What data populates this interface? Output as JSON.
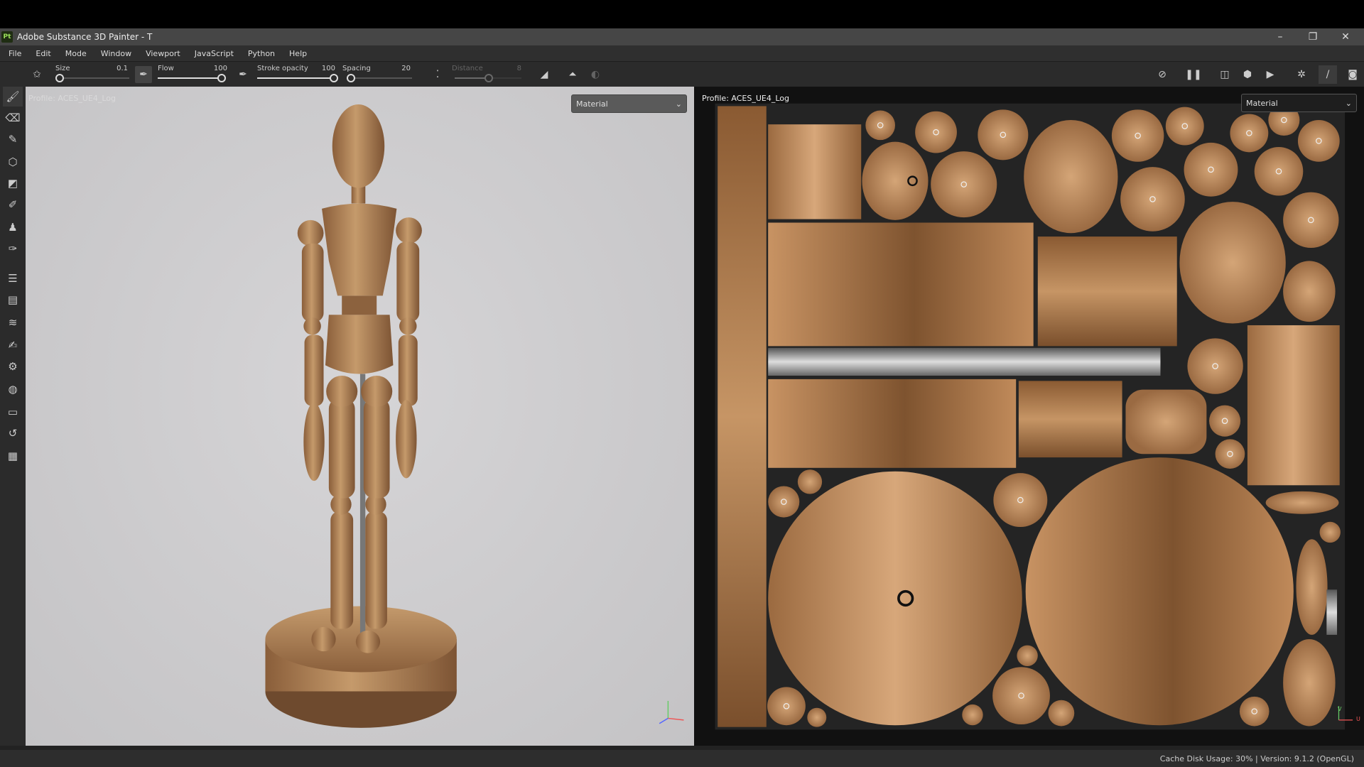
{
  "window": {
    "title": "Adobe Substance 3D Painter - T",
    "logo": "Pt",
    "minimize": "–",
    "restore": "❐",
    "close": "✕"
  },
  "menu": [
    "File",
    "Edit",
    "Mode",
    "Window",
    "Viewport",
    "JavaScript",
    "Python",
    "Help"
  ],
  "toolbar": {
    "size": {
      "label": "Size",
      "value": "0.1",
      "fraction": 0.0
    },
    "flow": {
      "label": "Flow",
      "value": "100",
      "fraction": 1.0
    },
    "stroke_opacity": {
      "label": "Stroke opacity",
      "value": "100",
      "fraction": 1.0
    },
    "spacing": {
      "label": "Spacing",
      "value": "20",
      "fraction": 0.0
    },
    "distance": {
      "label": "Distance",
      "value": "8",
      "fraction": 0.5
    }
  },
  "viewport3d": {
    "profile": "Profile: ACES_UE4_Log",
    "mode": "Material"
  },
  "viewport2d": {
    "profile": "Profile: ACES_UE4_Log",
    "mode": "Material",
    "axis_u": "U",
    "axis_v": "V"
  },
  "status": {
    "text": "Cache Disk Usage:   30% | Version: 9.1.2 (OpenGL)"
  },
  "colors": {
    "wood": "#b8895c",
    "wood_dark": "#7a5233",
    "accent": "#9be15a"
  }
}
